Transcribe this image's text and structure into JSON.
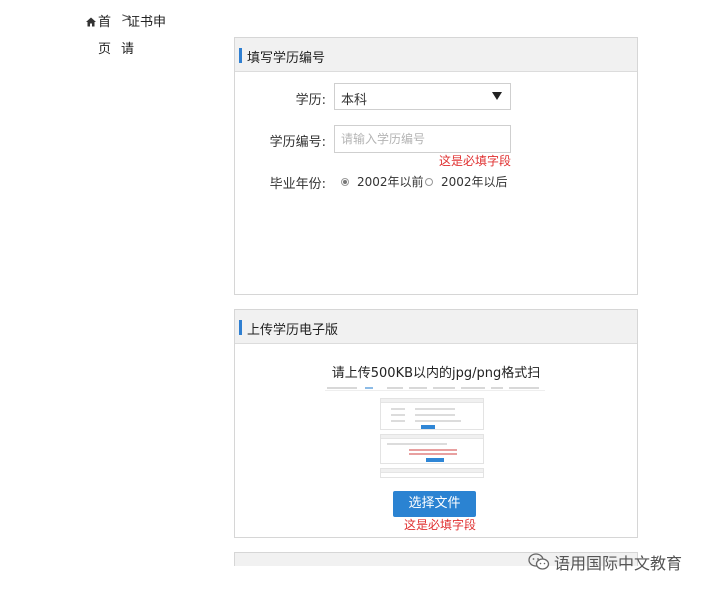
{
  "breadcrumb": {
    "home_label": "首",
    "home_label_cont": "页",
    "separator": ">",
    "current_label": "证书申",
    "current_label_cont": "请",
    "home_icon": "home-icon"
  },
  "education_panel": {
    "title": "填写学历编号",
    "level_label": "学历:",
    "level_value": "本科",
    "number_label": "学历编号:",
    "number_placeholder": "请输入学历编号",
    "number_value": "",
    "required_message": "这是必填字段",
    "graduation_label": "毕业年份:",
    "graduation_options": [
      {
        "label": "2002年以前",
        "selected": true
      },
      {
        "label": "2002年以后",
        "selected": false
      }
    ]
  },
  "upload_panel": {
    "title": "上传学历电子版",
    "hint": "请上传500KB以内的jpg/png格式扫",
    "button_label": "选择文件",
    "required_message": "这是必填字段"
  },
  "watermark": {
    "text": "语用国际中文教育",
    "icon": "wechat-icon"
  },
  "colors": {
    "accent": "#2f7fd1",
    "button": "#2b83d2",
    "error": "#e03131",
    "header_bg": "#f1f1f1"
  }
}
